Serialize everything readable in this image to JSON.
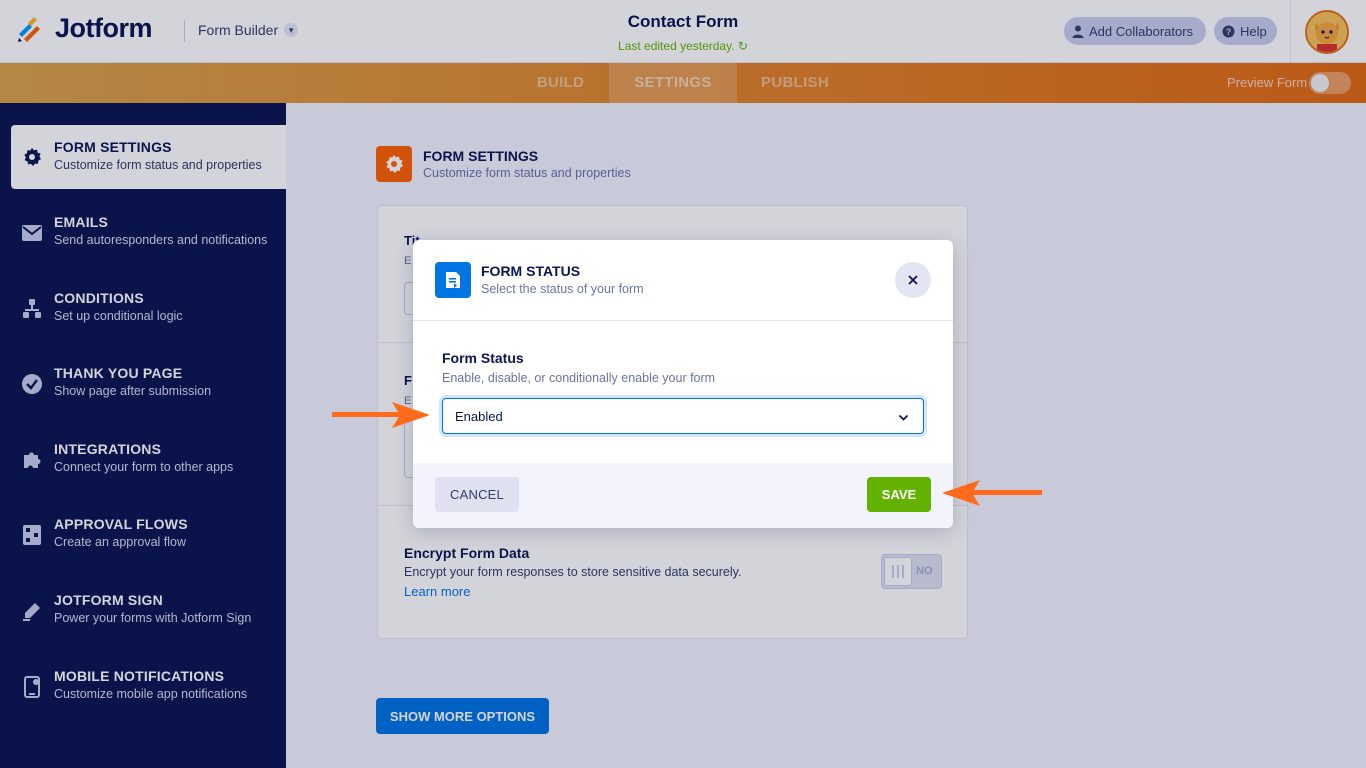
{
  "header": {
    "brand": "Jotform",
    "builder_switch": "Form Builder",
    "form_title": "Contact Form",
    "last_edited": "Last edited yesterday.",
    "add_collaborators": "Add Collaborators",
    "help": "Help"
  },
  "nav": {
    "tabs": [
      {
        "label": "BUILD"
      },
      {
        "label": "SETTINGS"
      },
      {
        "label": "PUBLISH"
      }
    ],
    "active_tab": "SETTINGS",
    "preview_label": "Preview Form",
    "preview_on": false
  },
  "sidebar": {
    "items": [
      {
        "title": "FORM SETTINGS",
        "subtitle": "Customize form status and properties",
        "icon": "gear-icon",
        "active": true
      },
      {
        "title": "EMAILS",
        "subtitle": "Send autoresponders and notifications",
        "icon": "envelope-icon"
      },
      {
        "title": "CONDITIONS",
        "subtitle": "Set up conditional logic",
        "icon": "hierarchy-icon"
      },
      {
        "title": "THANK YOU PAGE",
        "subtitle": "Show page after submission",
        "icon": "check-circle-icon"
      },
      {
        "title": "INTEGRATIONS",
        "subtitle": "Connect your form to other apps",
        "icon": "puzzle-icon"
      },
      {
        "title": "APPROVAL FLOWS",
        "subtitle": "Create an approval flow",
        "icon": "flow-icon"
      },
      {
        "title": "JOTFORM SIGN",
        "subtitle": "Power your forms with Jotform Sign",
        "icon": "pen-icon"
      },
      {
        "title": "MOBILE NOTIFICATIONS",
        "subtitle": "Customize mobile app notifications",
        "icon": "mobile-icon"
      }
    ]
  },
  "main": {
    "section_title": "FORM SETTINGS",
    "section_subtitle": "Customize form status and properties",
    "encrypt": {
      "title": "Encrypt Form Data",
      "description": "Encrypt your form responses to store sensitive data securely.",
      "link": "Learn more",
      "toggle_label": "NO"
    },
    "show_more": "SHOW MORE OPTIONS"
  },
  "modal": {
    "title": "FORM STATUS",
    "subtitle": "Select the status of your form",
    "field_label": "Form Status",
    "field_help": "Enable, disable, or conditionally enable your form",
    "selected_value": "Enabled",
    "cancel": "CANCEL",
    "save": "SAVE"
  },
  "colors": {
    "brand_navy": "#0a1551",
    "accent_orange": "#ff6100",
    "action_blue": "#0075e3",
    "save_green": "#64b200",
    "annotation_arrow": "#ff6b1a"
  }
}
